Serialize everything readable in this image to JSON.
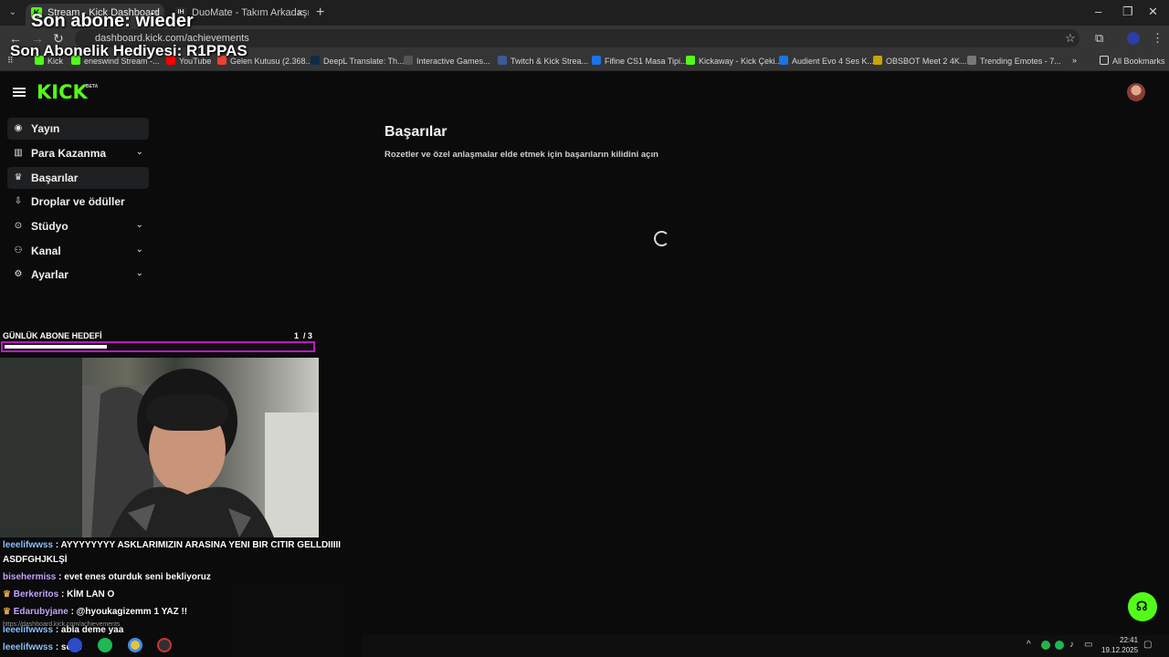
{
  "browser": {
    "tabs": [
      {
        "title": "Stream - Kick Dashboard",
        "active": true
      },
      {
        "title": "DuoMate - Takım Arkadaşı Bul",
        "active": false
      }
    ],
    "url": "dashboard.kick.com/achievements",
    "bookmarks": [
      "Kick",
      "eneswind Stream -...",
      "YouTube",
      "Gelen Kutusu (2.368...",
      "DeepL Translate: Th...",
      "Interactive Games...",
      "Twitch & Kick Strea...",
      "Fifine CS1 Masa Tipi...",
      "Kickaway - Kick Çeki...",
      "Audient Evo 4 Ses K...",
      "OBSBOT Meet 2 4K...",
      "Trending Emotes - 7..."
    ],
    "all_bookmarks": "All Bookmarks"
  },
  "overlay": {
    "last_sub": "Son abone: wieder",
    "last_gift": "Son Abonelik Hediyesi: R1PPAS"
  },
  "sidebar": {
    "items": [
      {
        "label": "Yayın",
        "icon": "broadcast-icon",
        "expandable": false
      },
      {
        "label": "Para Kazanma",
        "icon": "monetization-icon",
        "expandable": true
      },
      {
        "label": "Başarılar",
        "icon": "trophy-icon",
        "expandable": false
      },
      {
        "label": "Droplar ve ödüller",
        "icon": "drops-icon",
        "expandable": false
      },
      {
        "label": "Stüdyo",
        "icon": "studio-icon",
        "expandable": true
      },
      {
        "label": "Kanal",
        "icon": "channel-icon",
        "expandable": true
      },
      {
        "label": "Ayarlar",
        "icon": "gear-icon",
        "expandable": true
      }
    ]
  },
  "main": {
    "title": "Başarılar",
    "subtitle": "Rozetler ve özel anlaşmalar elde etmek için başarıların kilidini açın"
  },
  "goal": {
    "label": "GÜNLÜK ABONE HEDEFİ",
    "current": "1",
    "total": "/ 3",
    "progress": 0.333
  },
  "chat": [
    {
      "user": "leeelifwwss",
      "text": ": AYYYYYYYY ASKLARIMIZIN ARASINA YENI BIR CITIR GELLDIIIII"
    },
    {
      "user": "",
      "text": "ASDFGHJKLŞİ"
    },
    {
      "user": "bisehermiss",
      "text": ": evet enes oturduk seni bekliyoruz"
    },
    {
      "user": "Berkeritos",
      "text": ": KİM LAN O"
    },
    {
      "user": "Edarubyjane",
      "text": ": @hyoukagizemm 1 YAZ !!"
    },
    {
      "user": "leeelifwwss",
      "text": ": abla deme yaa"
    },
    {
      "user": "leeelifwwss",
      "text": ": sen.."
    }
  ],
  "status_url": "https://dashboard.kick.com/achievements",
  "taskbar": {
    "time": "22:41",
    "date": "19.12.2025"
  },
  "colors": {
    "kick_green": "#53fc18",
    "goal_border": "#c015c9",
    "background": "#0b0b0c"
  }
}
